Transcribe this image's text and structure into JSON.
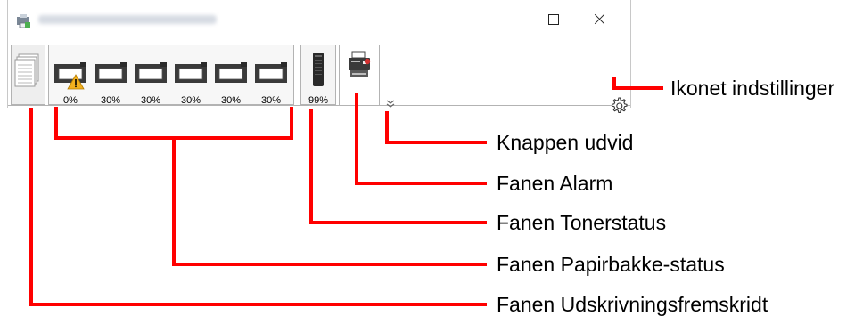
{
  "window": {
    "title": "",
    "controls": {
      "minimize": "minimize",
      "maximize": "maximize",
      "close": "close"
    }
  },
  "tabs": {
    "print_progress": {
      "icon": "print-job-stack-icon"
    },
    "paper_trays": [
      {
        "level": "0%",
        "warning": true
      },
      {
        "level": "30%",
        "warning": false
      },
      {
        "level": "30%",
        "warning": false
      },
      {
        "level": "30%",
        "warning": false
      },
      {
        "level": "30%",
        "warning": false
      },
      {
        "level": "30%",
        "warning": false
      }
    ],
    "toner": {
      "level": "99%"
    },
    "alarm": {
      "icon": "printer-alarm-icon"
    }
  },
  "icons": {
    "settings": "gear-icon",
    "expand": "double-chevron-down-icon"
  },
  "callouts": {
    "settings_icon": "Ikonet indstillinger",
    "expand_button": "Knappen udvid",
    "alarm_tab": "Fanen Alarm",
    "toner_tab": "Fanen Tonerstatus",
    "paper_tab": "Fanen Papirbakke-status",
    "print_tab": "Fanen Udskrivningsfremskridt"
  },
  "colors": {
    "callout_line": "#ff0000",
    "warning": "#f2b01e",
    "tray_dark": "#3a3a3a"
  }
}
